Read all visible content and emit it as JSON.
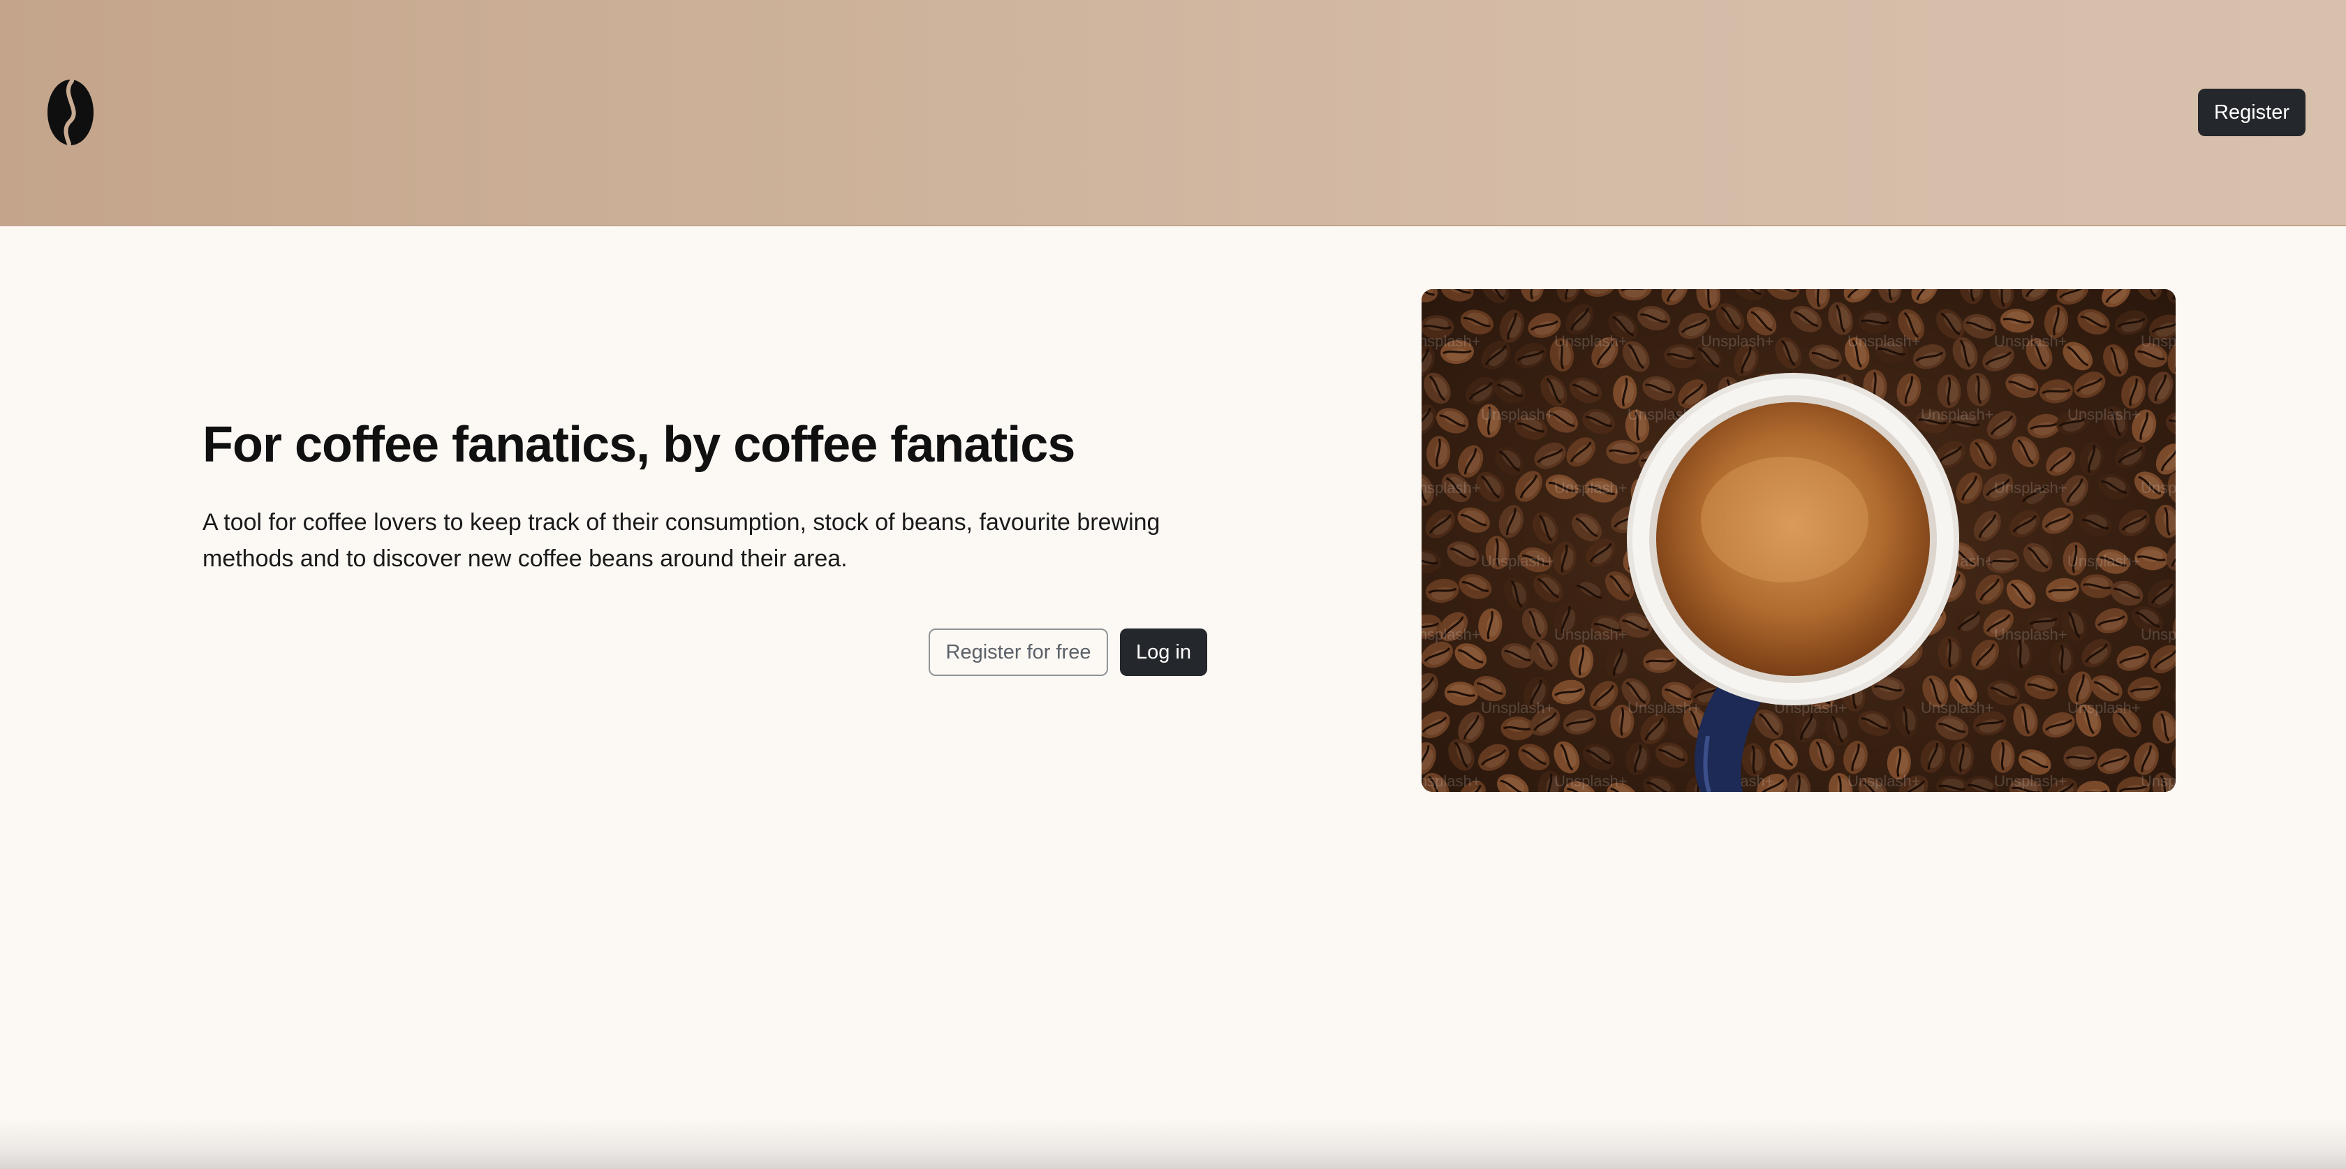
{
  "header": {
    "logo_icon": "coffee-bean-icon",
    "register_label": "Register"
  },
  "hero": {
    "title": "For coffee fanatics, by coffee fanatics",
    "description": "A tool for coffee lovers to keep track of their consumption, stock of beans, favourite brewing methods and to discover new coffee beans around their area.",
    "register_free_label": "Register for free",
    "login_label": "Log in",
    "image_watermark": "Unsplash+"
  },
  "colors": {
    "header_bg": "#c9ab92",
    "page_bg": "#fcf8f4",
    "button_dark": "#24272b"
  }
}
